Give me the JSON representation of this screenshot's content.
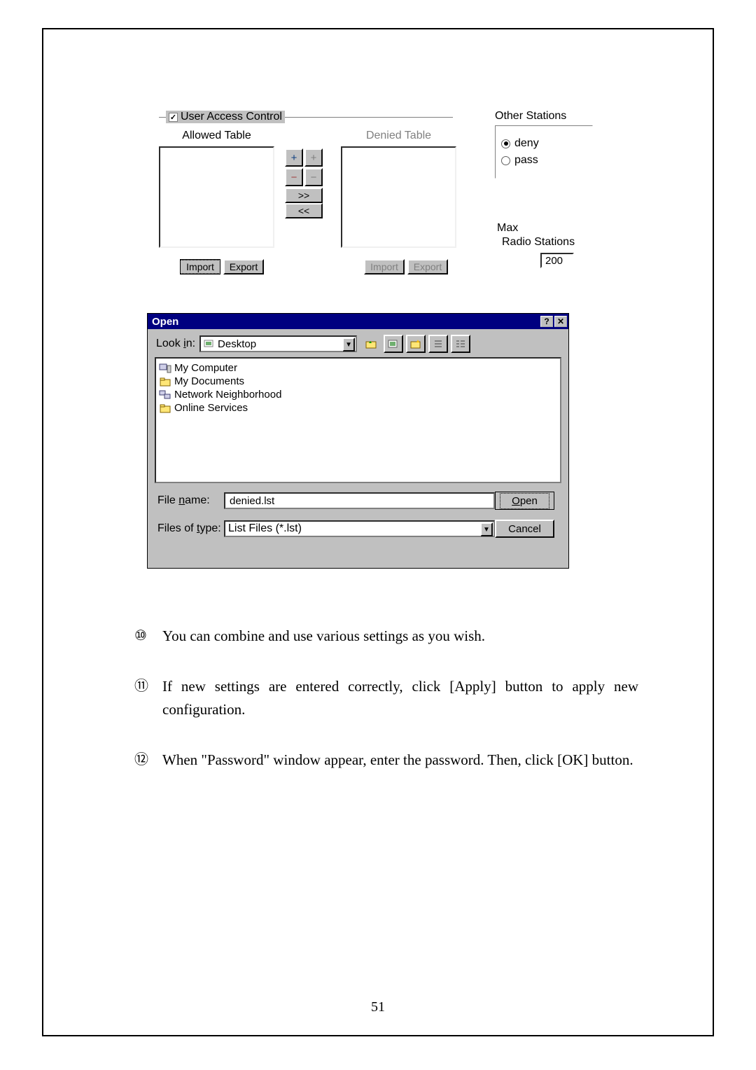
{
  "page_number": "51",
  "uac": {
    "checkbox_label": "User Access Control",
    "checkbox_checked": true,
    "allowed_title": "Allowed Table",
    "denied_title": "Denied Table",
    "btn_plus": "+",
    "btn_plus_dim": "+",
    "btn_minus": "−",
    "btn_minus_dim": "−",
    "btn_right": ">>",
    "btn_left": "<<",
    "import_label": "Import",
    "export_label": "Export",
    "other_stations_legend": "Other Stations",
    "radio_deny": "deny",
    "radio_pass": "pass",
    "other_selected": "deny",
    "max_label1": "Max",
    "max_label2": "Radio Stations",
    "max_value": "200"
  },
  "open": {
    "title": "Open",
    "look_in_label": "Look in:",
    "look_in_value": "Desktop",
    "toolbar": {
      "up": "up-one-level-icon",
      "desktop": "desktop-icon",
      "newfolder": "new-folder-icon",
      "list": "list-view-icon",
      "details": "details-view-icon"
    },
    "files": [
      {
        "icon": "computer-icon",
        "name": "My Computer"
      },
      {
        "icon": "folder-icon",
        "name": "My Documents"
      },
      {
        "icon": "network-icon",
        "name": "Network Neighborhood"
      },
      {
        "icon": "folder-icon",
        "name": "Online Services"
      }
    ],
    "filename_label": "File name:",
    "filename_value": "denied.lst",
    "filetype_label": "Files of type:",
    "filetype_value": "List Files (*.lst)",
    "open_btn": "Open",
    "cancel_btn": "Cancel"
  },
  "body": {
    "items": [
      {
        "num": "⑩",
        "text": "You can combine and use various settings as you wish."
      },
      {
        "num": "⑪",
        "text": "If new settings are entered correctly, click [Apply] button to apply new configuration."
      },
      {
        "num": "⑫",
        "text": "When \"Password\" window appear, enter the password. Then, click [OK] button."
      }
    ]
  }
}
